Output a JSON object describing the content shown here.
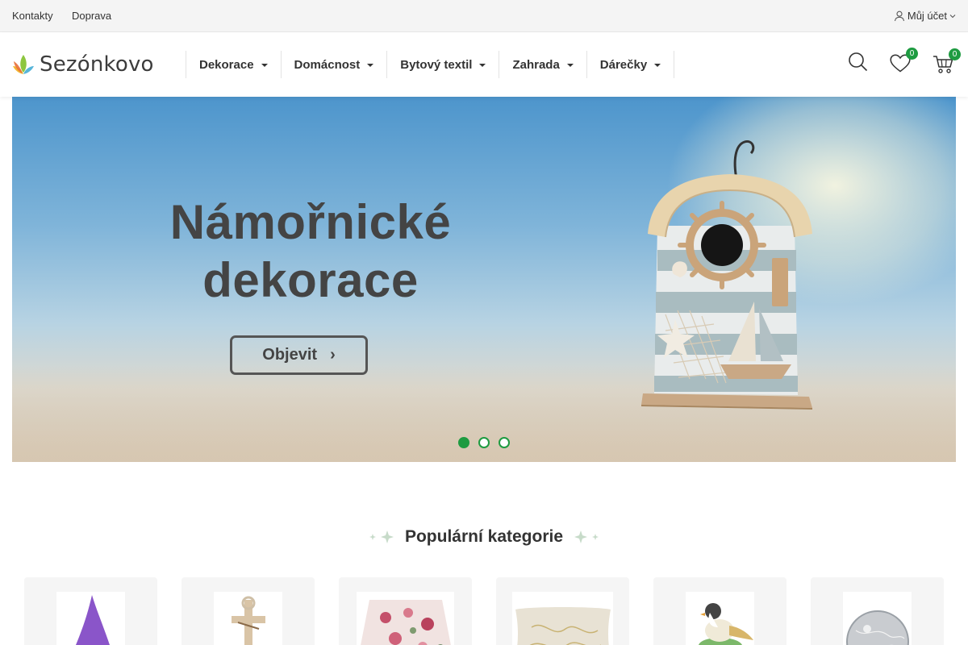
{
  "topbar": {
    "links": [
      "Kontakty",
      "Doprava"
    ],
    "account_label": "Můj účet",
    "account_icon": "user-icon"
  },
  "header": {
    "logo_text": "Sezónkovo",
    "nav": [
      "Dekorace",
      "Domácnost",
      "Bytový textil",
      "Zahrada",
      "Dárečky"
    ],
    "wishlist_count": "0",
    "cart_count": "0",
    "icons": [
      "search-icon",
      "heart-icon",
      "cart-icon"
    ]
  },
  "banner": {
    "title_line1": "Námořnické",
    "title_line2": "dekorace",
    "button_label": "Objevit",
    "button_arrow": "›",
    "slides": 3,
    "active_slide": 1
  },
  "categories": {
    "title": "Populární kategorie",
    "items": [
      "purple-gnome",
      "wooden-cross",
      "floral-table-runner",
      "gold-pattern-pillow",
      "bird-figurine",
      "glass-light-ball"
    ]
  },
  "colors": {
    "accent": "#1e9b41",
    "topbar_bg": "#f4f4f4",
    "text": "#333333"
  }
}
